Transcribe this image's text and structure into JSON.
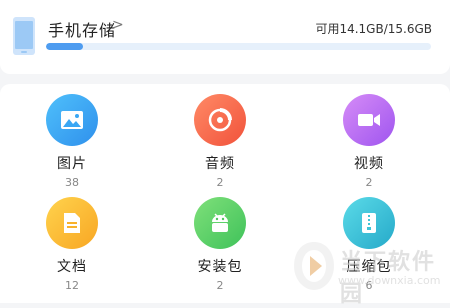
{
  "storage": {
    "title": "手机存储",
    "chevron": ">",
    "usage_text": "可用14.1GB/15.6GB",
    "used_fraction": 0.096
  },
  "categories": [
    {
      "label": "图片",
      "count": "38",
      "icon": "image-icon",
      "color": "#3aa7f4"
    },
    {
      "label": "音频",
      "count": "2",
      "icon": "music-disc-icon",
      "color": "#f4694b"
    },
    {
      "label": "视频",
      "count": "2",
      "icon": "video-camera-icon",
      "color": "#b56cf2"
    },
    {
      "label": "文档",
      "count": "12",
      "icon": "document-icon",
      "color": "#fbb934"
    },
    {
      "label": "安装包",
      "count": "2",
      "icon": "android-icon",
      "color": "#5dd16a"
    },
    {
      "label": "压缩包",
      "count": "6",
      "icon": "zip-archive-icon",
      "color": "#3fc4d6"
    }
  ],
  "watermark": {
    "text": "当下软件园",
    "url": "www.downxia.com"
  }
}
